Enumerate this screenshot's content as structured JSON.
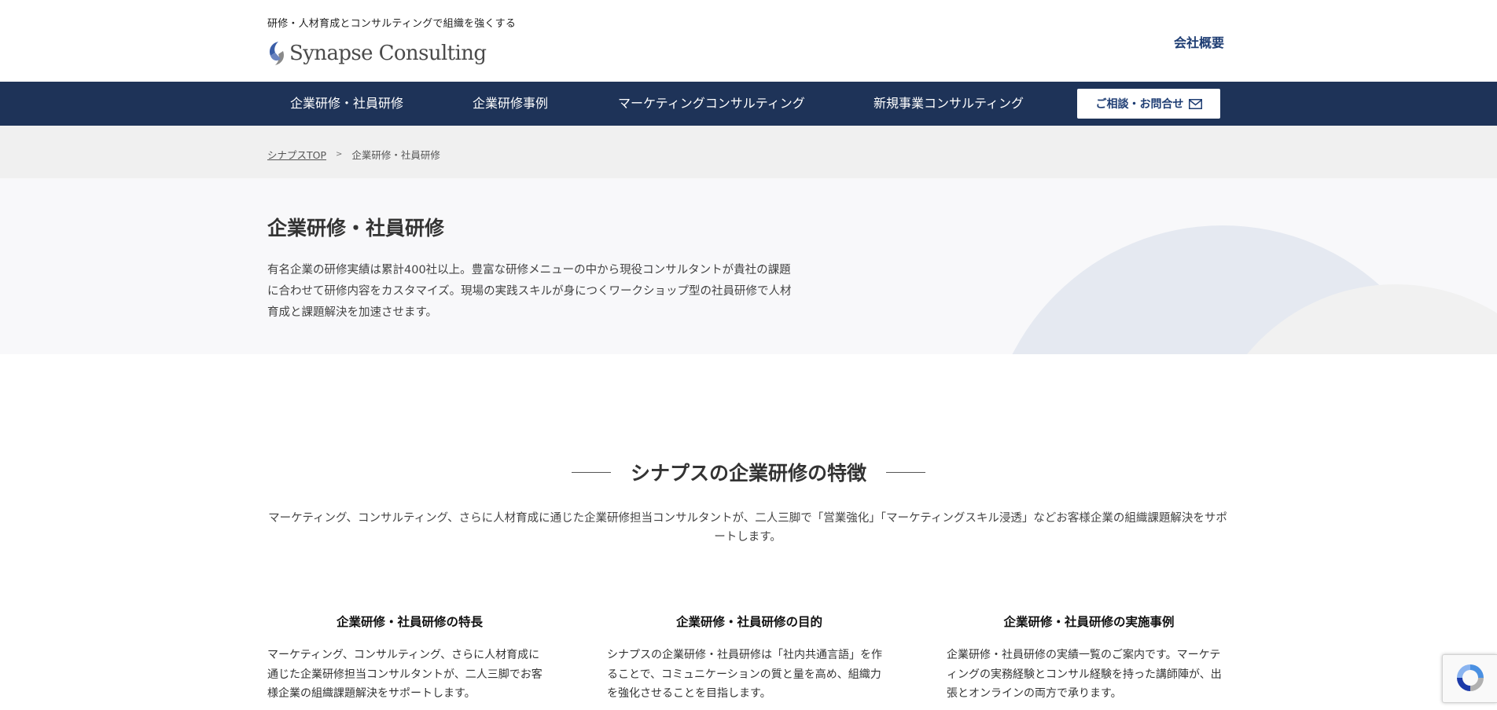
{
  "header": {
    "tagline": "研修・人材育成とコンサルティングで組織を強くする",
    "logo_text": "Synapse Consulting",
    "company_link": "会社概要"
  },
  "nav": {
    "items": [
      {
        "label": "企業研修・社員研修"
      },
      {
        "label": "企業研修事例"
      },
      {
        "label": "マーケティングコンサルティング"
      },
      {
        "label": "新規事業コンサルティング"
      }
    ],
    "cta_label": "ご相談・お問合せ"
  },
  "breadcrumb": {
    "home": "シナプスTOP",
    "separator": ">",
    "current": "企業研修・社員研修"
  },
  "hero": {
    "title": "企業研修・社員研修",
    "description": "有名企業の研修実績は累計400社以上。豊富な研修メニューの中から現役コンサルタントが貴社の課題に合わせて研修内容をカスタマイズ。現場の実践スキルが身につくワークショップ型の社員研修で人材育成と課題解決を加速させます。"
  },
  "features": {
    "title": "シナプスの企業研修の特徴",
    "description": "マーケティング、コンサルティング、さらに人材育成に通じた企業研修担当コンサルタントが、二人三脚で「営業強化」「マーケティングスキル浸透」などお客様企業の組織課題解決をサポートします。",
    "items": [
      {
        "title": "企業研修・社員研修の特長",
        "text": "マーケティング、コンサルティング、さらに人材育成に通じた企業研修担当コンサルタントが、二人三脚でお客様企業の組織課題解決をサポートします。"
      },
      {
        "title": "企業研修・社員研修の目的",
        "text": "シナプスの企業研修・社員研修は「社内共通言語」を作ることで、コミュニケーションの質と量を高め、組織力を強化させることを目指します。"
      },
      {
        "title": "企業研修・社員研修の実施事例",
        "text": "企業研修・社員研修の実績一覧のご案内です。マーケティングの実務経験とコンサル経験を持った講師陣が、出張とオンラインの両方で承ります。"
      }
    ]
  },
  "colors": {
    "nav_bg": "#1e3358",
    "accent": "#1e3d73",
    "breadcrumb_bg": "#f0f0f0",
    "hero_bg": "#f8f8fa",
    "hero_arc": "#e5e9f1"
  },
  "icons": {
    "logo": "synapse-logo-mark",
    "cta": "mail-icon",
    "badge": "recaptcha-icon"
  }
}
